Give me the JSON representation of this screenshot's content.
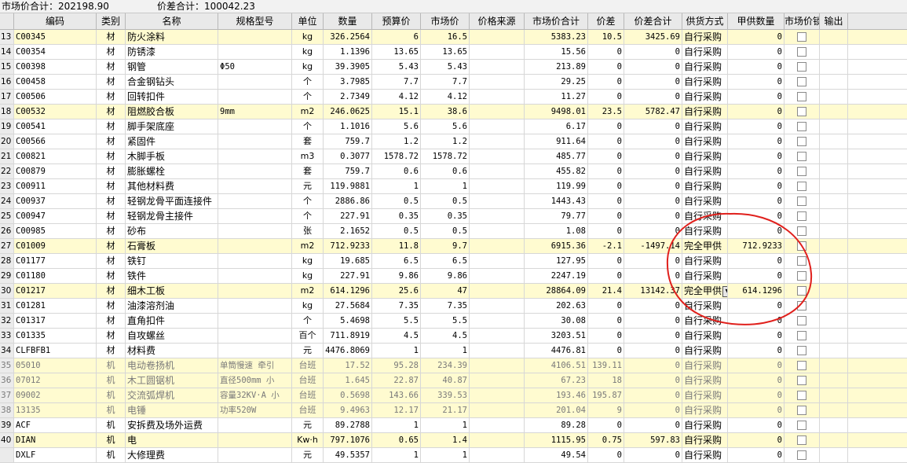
{
  "summary": {
    "market_total": "市场价合计：202198.90",
    "diff_total": "价差合计：100042.23"
  },
  "columns": [
    "编码",
    "类别",
    "名称",
    "规格型号",
    "单位",
    "数量",
    "预算价",
    "市场价",
    "价格来源",
    "市场价合计",
    "价差",
    "价差合计",
    "供货方式",
    "甲供数量",
    "市场价锁定",
    "输出"
  ],
  "rows": [
    {
      "idx": "13",
      "code": "C00345",
      "cat": "材",
      "name": "防火涂料",
      "spec": "",
      "unit": "kg",
      "qty": "326.2564",
      "budget": "6",
      "market": "16.5",
      "source": "",
      "mtotal": "5383.23",
      "diff": "10.5",
      "dtotal": "3425.69",
      "supply": "自行采购",
      "jqty": "0",
      "hl": true,
      "mach": false
    },
    {
      "idx": "14",
      "code": "C00354",
      "cat": "材",
      "name": "防锈漆",
      "spec": "",
      "unit": "kg",
      "qty": "1.1396",
      "budget": "13.65",
      "market": "13.65",
      "source": "",
      "mtotal": "15.56",
      "diff": "0",
      "dtotal": "0",
      "supply": "自行采购",
      "jqty": "0",
      "hl": false,
      "mach": false
    },
    {
      "idx": "15",
      "code": "C00398",
      "cat": "材",
      "name": "钢管",
      "spec": "Φ50",
      "unit": "kg",
      "qty": "39.3905",
      "budget": "5.43",
      "market": "5.43",
      "source": "",
      "mtotal": "213.89",
      "diff": "0",
      "dtotal": "0",
      "supply": "自行采购",
      "jqty": "0",
      "hl": false,
      "mach": false
    },
    {
      "idx": "16",
      "code": "C00458",
      "cat": "材",
      "name": "合金钢钻头",
      "spec": "",
      "unit": "个",
      "qty": "3.7985",
      "budget": "7.7",
      "market": "7.7",
      "source": "",
      "mtotal": "29.25",
      "diff": "0",
      "dtotal": "0",
      "supply": "自行采购",
      "jqty": "0",
      "hl": false,
      "mach": false
    },
    {
      "idx": "17",
      "code": "C00506",
      "cat": "材",
      "name": "回转扣件",
      "spec": "",
      "unit": "个",
      "qty": "2.7349",
      "budget": "4.12",
      "market": "4.12",
      "source": "",
      "mtotal": "11.27",
      "diff": "0",
      "dtotal": "0",
      "supply": "自行采购",
      "jqty": "0",
      "hl": false,
      "mach": false
    },
    {
      "idx": "18",
      "code": "C00532",
      "cat": "材",
      "name": "阻燃胶合板",
      "spec": "9mm",
      "unit": "m2",
      "qty": "246.0625",
      "budget": "15.1",
      "market": "38.6",
      "source": "",
      "mtotal": "9498.01",
      "diff": "23.5",
      "dtotal": "5782.47",
      "supply": "自行采购",
      "jqty": "0",
      "hl": true,
      "mach": false
    },
    {
      "idx": "19",
      "code": "C00541",
      "cat": "材",
      "name": "脚手架底座",
      "spec": "",
      "unit": "个",
      "qty": "1.1016",
      "budget": "5.6",
      "market": "5.6",
      "source": "",
      "mtotal": "6.17",
      "diff": "0",
      "dtotal": "0",
      "supply": "自行采购",
      "jqty": "0",
      "hl": false,
      "mach": false
    },
    {
      "idx": "20",
      "code": "C00566",
      "cat": "材",
      "name": "紧固件",
      "spec": "",
      "unit": "套",
      "qty": "759.7",
      "budget": "1.2",
      "market": "1.2",
      "source": "",
      "mtotal": "911.64",
      "diff": "0",
      "dtotal": "0",
      "supply": "自行采购",
      "jqty": "0",
      "hl": false,
      "mach": false
    },
    {
      "idx": "21",
      "code": "C00821",
      "cat": "材",
      "name": "木脚手板",
      "spec": "",
      "unit": "m3",
      "qty": "0.3077",
      "budget": "1578.72",
      "market": "1578.72",
      "source": "",
      "mtotal": "485.77",
      "diff": "0",
      "dtotal": "0",
      "supply": "自行采购",
      "jqty": "0",
      "hl": false,
      "mach": false
    },
    {
      "idx": "22",
      "code": "C00879",
      "cat": "材",
      "name": "膨胀螺栓",
      "spec": "",
      "unit": "套",
      "qty": "759.7",
      "budget": "0.6",
      "market": "0.6",
      "source": "",
      "mtotal": "455.82",
      "diff": "0",
      "dtotal": "0",
      "supply": "自行采购",
      "jqty": "0",
      "hl": false,
      "mach": false
    },
    {
      "idx": "23",
      "code": "C00911",
      "cat": "材",
      "name": "其他材料费",
      "spec": "",
      "unit": "元",
      "qty": "119.9881",
      "budget": "1",
      "market": "1",
      "source": "",
      "mtotal": "119.99",
      "diff": "0",
      "dtotal": "0",
      "supply": "自行采购",
      "jqty": "0",
      "hl": false,
      "mach": false
    },
    {
      "idx": "24",
      "code": "C00937",
      "cat": "材",
      "name": "轻钢龙骨平面连接件",
      "spec": "",
      "unit": "个",
      "qty": "2886.86",
      "budget": "0.5",
      "market": "0.5",
      "source": "",
      "mtotal": "1443.43",
      "diff": "0",
      "dtotal": "0",
      "supply": "自行采购",
      "jqty": "0",
      "hl": false,
      "mach": false
    },
    {
      "idx": "25",
      "code": "C00947",
      "cat": "材",
      "name": "轻钢龙骨主接件",
      "spec": "",
      "unit": "个",
      "qty": "227.91",
      "budget": "0.35",
      "market": "0.35",
      "source": "",
      "mtotal": "79.77",
      "diff": "0",
      "dtotal": "0",
      "supply": "自行采购",
      "jqty": "0",
      "hl": false,
      "mach": false
    },
    {
      "idx": "26",
      "code": "C00985",
      "cat": "材",
      "name": "砂布",
      "spec": "",
      "unit": "张",
      "qty": "2.1652",
      "budget": "0.5",
      "market": "0.5",
      "source": "",
      "mtotal": "1.08",
      "diff": "0",
      "dtotal": "0",
      "supply": "自行采购",
      "jqty": "0",
      "hl": false,
      "mach": false
    },
    {
      "idx": "27",
      "code": "C01009",
      "cat": "材",
      "name": "石膏板",
      "spec": "",
      "unit": "m2",
      "qty": "712.9233",
      "budget": "11.8",
      "market": "9.7",
      "source": "",
      "mtotal": "6915.36",
      "diff": "-2.1",
      "dtotal": "-1497.14",
      "supply": "完全甲供",
      "jqty": "712.9233",
      "hl": true,
      "mach": false
    },
    {
      "idx": "28",
      "code": "C01177",
      "cat": "材",
      "name": "铁钉",
      "spec": "",
      "unit": "kg",
      "qty": "19.685",
      "budget": "6.5",
      "market": "6.5",
      "source": "",
      "mtotal": "127.95",
      "diff": "0",
      "dtotal": "0",
      "supply": "自行采购",
      "jqty": "0",
      "hl": false,
      "mach": false
    },
    {
      "idx": "29",
      "code": "C01180",
      "cat": "材",
      "name": "铁件",
      "spec": "",
      "unit": "kg",
      "qty": "227.91",
      "budget": "9.86",
      "market": "9.86",
      "source": "",
      "mtotal": "2247.19",
      "diff": "0",
      "dtotal": "0",
      "supply": "自行采购",
      "jqty": "0",
      "hl": false,
      "mach": false
    },
    {
      "idx": "30",
      "code": "C01217",
      "cat": "材",
      "name": "细木工板",
      "spec": "",
      "unit": "m2",
      "qty": "614.1296",
      "budget": "25.6",
      "market": "47",
      "source": "",
      "mtotal": "28864.09",
      "diff": "21.4",
      "dtotal": "13142.37",
      "supply": "完全甲供",
      "jqty": "614.1296",
      "hl": true,
      "mach": false,
      "dropdown": true
    },
    {
      "idx": "31",
      "code": "C01281",
      "cat": "材",
      "name": "油漆溶剂油",
      "spec": "",
      "unit": "kg",
      "qty": "27.5684",
      "budget": "7.35",
      "market": "7.35",
      "source": "",
      "mtotal": "202.63",
      "diff": "0",
      "dtotal": "0",
      "supply": "自行采购",
      "jqty": "0",
      "hl": false,
      "mach": false
    },
    {
      "idx": "32",
      "code": "C01317",
      "cat": "材",
      "name": "直角扣件",
      "spec": "",
      "unit": "个",
      "qty": "5.4698",
      "budget": "5.5",
      "market": "5.5",
      "source": "",
      "mtotal": "30.08",
      "diff": "0",
      "dtotal": "0",
      "supply": "自行采购",
      "jqty": "0",
      "hl": false,
      "mach": false
    },
    {
      "idx": "33",
      "code": "C01335",
      "cat": "材",
      "name": "自攻螺丝",
      "spec": "",
      "unit": "百个",
      "qty": "711.8919",
      "budget": "4.5",
      "market": "4.5",
      "source": "",
      "mtotal": "3203.51",
      "diff": "0",
      "dtotal": "0",
      "supply": "自行采购",
      "jqty": "0",
      "hl": false,
      "mach": false
    },
    {
      "idx": "34",
      "code": "CLFBFB1",
      "cat": "材",
      "name": "材料费",
      "spec": "",
      "unit": "元",
      "qty": "4476.8069",
      "budget": "1",
      "market": "1",
      "source": "",
      "mtotal": "4476.81",
      "diff": "0",
      "dtotal": "0",
      "supply": "自行采购",
      "jqty": "0",
      "hl": false,
      "mach": false
    },
    {
      "idx": "35",
      "code": "05010",
      "cat": "机",
      "name": "电动卷扬机",
      "spec": "单筒慢速 牵引",
      "unit": "台班",
      "qty": "17.52",
      "budget": "95.28",
      "market": "234.39",
      "source": "",
      "mtotal": "4106.51",
      "diff": "139.11",
      "dtotal": "0",
      "supply": "自行采购",
      "jqty": "0",
      "hl": true,
      "mach": true
    },
    {
      "idx": "36",
      "code": "07012",
      "cat": "机",
      "name": "木工圆锯机",
      "spec": "直径500mm 小",
      "unit": "台班",
      "qty": "1.645",
      "budget": "22.87",
      "market": "40.87",
      "source": "",
      "mtotal": "67.23",
      "diff": "18",
      "dtotal": "0",
      "supply": "自行采购",
      "jqty": "0",
      "hl": true,
      "mach": true
    },
    {
      "idx": "37",
      "code": "09002",
      "cat": "机",
      "name": "交流弧焊机",
      "spec": "容量32KV·A 小",
      "unit": "台班",
      "qty": "0.5698",
      "budget": "143.66",
      "market": "339.53",
      "source": "",
      "mtotal": "193.46",
      "diff": "195.87",
      "dtotal": "0",
      "supply": "自行采购",
      "jqty": "0",
      "hl": true,
      "mach": true
    },
    {
      "idx": "38",
      "code": "13135",
      "cat": "机",
      "name": "电锤",
      "spec": "功率520W",
      "unit": "台班",
      "qty": "9.4963",
      "budget": "12.17",
      "market": "21.17",
      "source": "",
      "mtotal": "201.04",
      "diff": "9",
      "dtotal": "0",
      "supply": "自行采购",
      "jqty": "0",
      "hl": true,
      "mach": true
    },
    {
      "idx": "39",
      "code": "ACF",
      "cat": "机",
      "name": "安拆费及场外运费",
      "spec": "",
      "unit": "元",
      "qty": "89.2788",
      "budget": "1",
      "market": "1",
      "source": "",
      "mtotal": "89.28",
      "diff": "0",
      "dtotal": "0",
      "supply": "自行采购",
      "jqty": "0",
      "hl": false,
      "mach": false
    },
    {
      "idx": "40",
      "code": "DIAN",
      "cat": "机",
      "name": "电",
      "spec": "",
      "unit": "Kw·h",
      "qty": "797.1076",
      "budget": "0.65",
      "market": "1.4",
      "source": "",
      "mtotal": "1115.95",
      "diff": "0.75",
      "dtotal": "597.83",
      "supply": "自行采购",
      "jqty": "0",
      "hl": true,
      "mach": false
    },
    {
      "idx": "",
      "code": "DXLF",
      "cat": "机",
      "name": "大修理费",
      "spec": "",
      "unit": "元",
      "qty": "49.5357",
      "budget": "1",
      "market": "1",
      "source": "",
      "mtotal": "49.54",
      "diff": "0",
      "dtotal": "0",
      "supply": "自行采购",
      "jqty": "0",
      "hl": false,
      "mach": false
    }
  ],
  "colors": {
    "highlight_row": "#fffbd0",
    "annotation": "#e0201c",
    "header_bg": "#e9e9e9"
  },
  "icons": {
    "dropdown": "chevron-down-icon",
    "checkbox": "checkbox-icon"
  }
}
